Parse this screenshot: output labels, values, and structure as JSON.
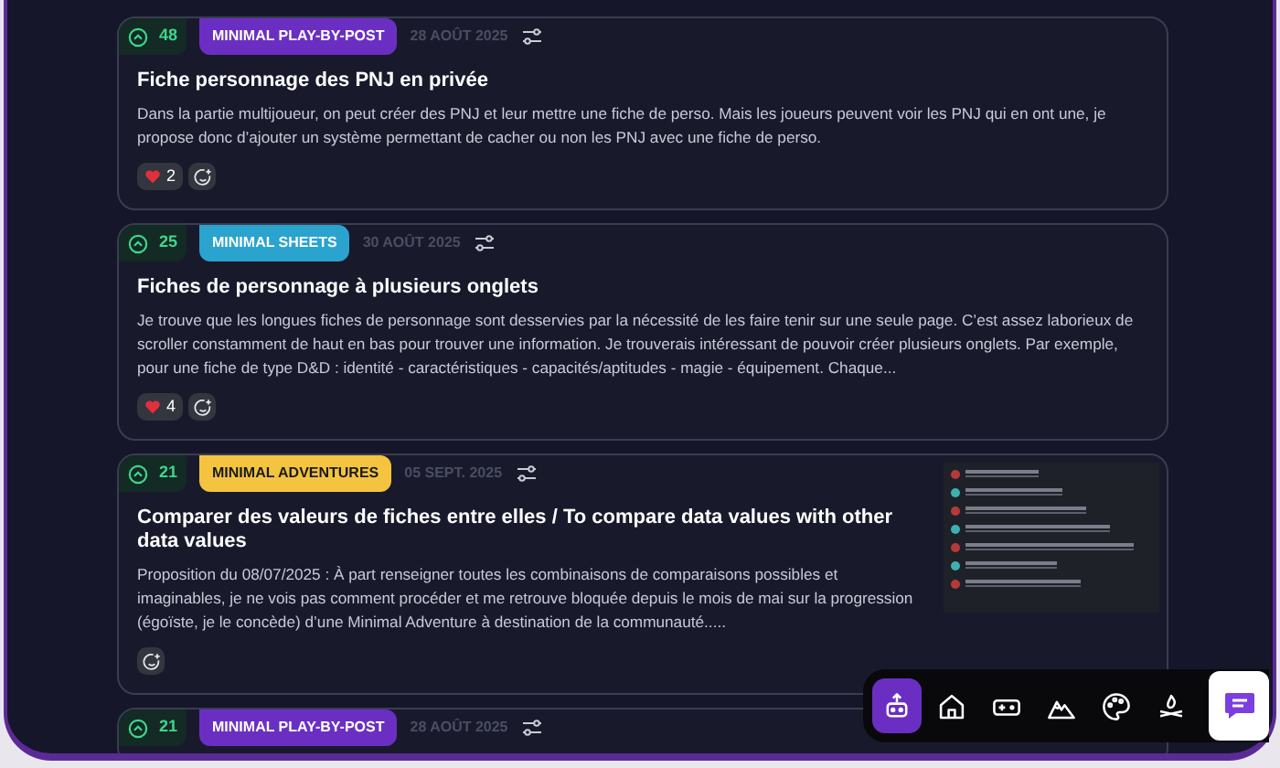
{
  "posts": [
    {
      "votes": "48",
      "tag": {
        "label": "MINIMAL PLAY-BY-POST",
        "color": "#6a2fc2"
      },
      "date": "28 AOÛT 2025",
      "title": "Fiche personnage des PNJ en privée",
      "body": "Dans la partie multijoueur, on peut créer des PNJ et leur mettre une fiche de perso. Mais les joueurs peuvent voir les PNJ qui en ont une, je propose donc d’ajouter un système permettant de cacher ou non les PNJ avec une fiche de perso.",
      "reactions": [
        {
          "count": "2"
        }
      ]
    },
    {
      "votes": "25",
      "tag": {
        "label": "MINIMAL SHEETS",
        "color": "#2aa3cf"
      },
      "date": "30 AOÛT 2025",
      "title": "Fiches de personnage à plusieurs onglets",
      "body": "Je trouve que les longues fiches de personnage sont desservies par la nécessité de les faire tenir sur une seule page. C’est assez laborieux de scroller constamment de haut en bas pour trouver une information. Je trouverais intéressant de pouvoir créer plusieurs onglets. Par exemple, pour une fiche de type D&D : identité - caractéristiques - capacités/aptitudes - magie - équipement. Chaque...",
      "reactions": [
        {
          "count": "4"
        }
      ]
    },
    {
      "votes": "21",
      "tag": {
        "label": "MINIMAL ADVENTURES",
        "color": "#f4c441"
      },
      "date": "05 SEPT. 2025",
      "title": "Comparer des valeurs de fiches entre elles / To compare data values with other data values",
      "body": "Proposition du 08/07/2025 : À part renseigner toutes les combinaisons de comparaisons possibles et imaginables, je ne vois pas comment procéder et me retrouve bloquée depuis le mois de mai sur la progression (égoïste, je le concède) d’une Minimal Adventure à destination de la communauté.....",
      "attachment": {
        "kind": "screenshot"
      }
    },
    {
      "votes": "21",
      "tag": {
        "label": "MINIMAL PLAY-BY-POST",
        "color": "#6a2fc2"
      },
      "date": "28 AOÛT 2025"
    }
  ],
  "dock": {
    "items": [
      {
        "kind": "robot",
        "selected": true
      },
      {
        "kind": "home",
        "selected": false
      },
      {
        "kind": "gamepad",
        "selected": false
      },
      {
        "kind": "mountain",
        "selected": false
      },
      {
        "kind": "palette",
        "selected": false
      },
      {
        "kind": "campfire",
        "selected": false
      }
    ]
  }
}
